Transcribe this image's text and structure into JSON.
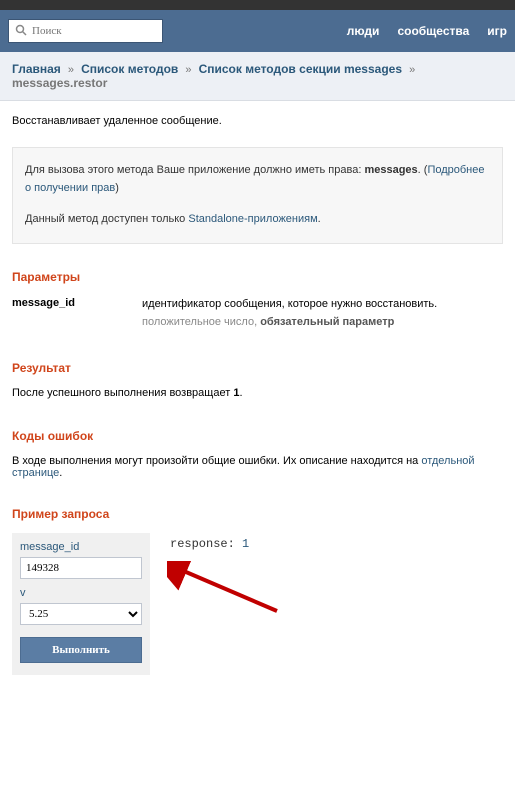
{
  "search": {
    "placeholder": "Поиск"
  },
  "nav": {
    "people": "люди",
    "communities": "сообщества",
    "games": "игр"
  },
  "breadcrumb": {
    "home": "Главная",
    "methods": "Список методов",
    "section": "Список методов секции messages",
    "current": "messages.restor"
  },
  "description": "Восстанавливает удаленное сообщение.",
  "infobox": {
    "line1_prefix": "Для вызова этого метода Ваше приложение должно иметь права: ",
    "line1_bold": "messages",
    "line1_link": "Подробнее о получении прав",
    "line2_prefix": "Данный метод доступен только ",
    "line2_link": "Standalone-приложениям"
  },
  "sections": {
    "params_title": "Параметры",
    "result_title": "Результат",
    "errors_title": "Коды ошибок",
    "example_title": "Пример запроса"
  },
  "param": {
    "name": "message_id",
    "desc": "идентификатор сообщения, которое нужно восстановить.",
    "meta_plain": "положительное число, ",
    "meta_bold": "обязательный параметр"
  },
  "result": {
    "prefix": "После успешного выполнения возвращает ",
    "value": "1",
    "suffix": "."
  },
  "errors": {
    "prefix": "В ходе выполнения могут произойти общие ошибки. Их описание находится на ",
    "link": "отдельной странице",
    "suffix": "."
  },
  "example": {
    "label_msgid": "message_id",
    "value_msgid": "149328",
    "label_v": "v",
    "value_v": "5.25",
    "execute": "Выполнить",
    "response_key": "response:",
    "response_val": "1"
  }
}
